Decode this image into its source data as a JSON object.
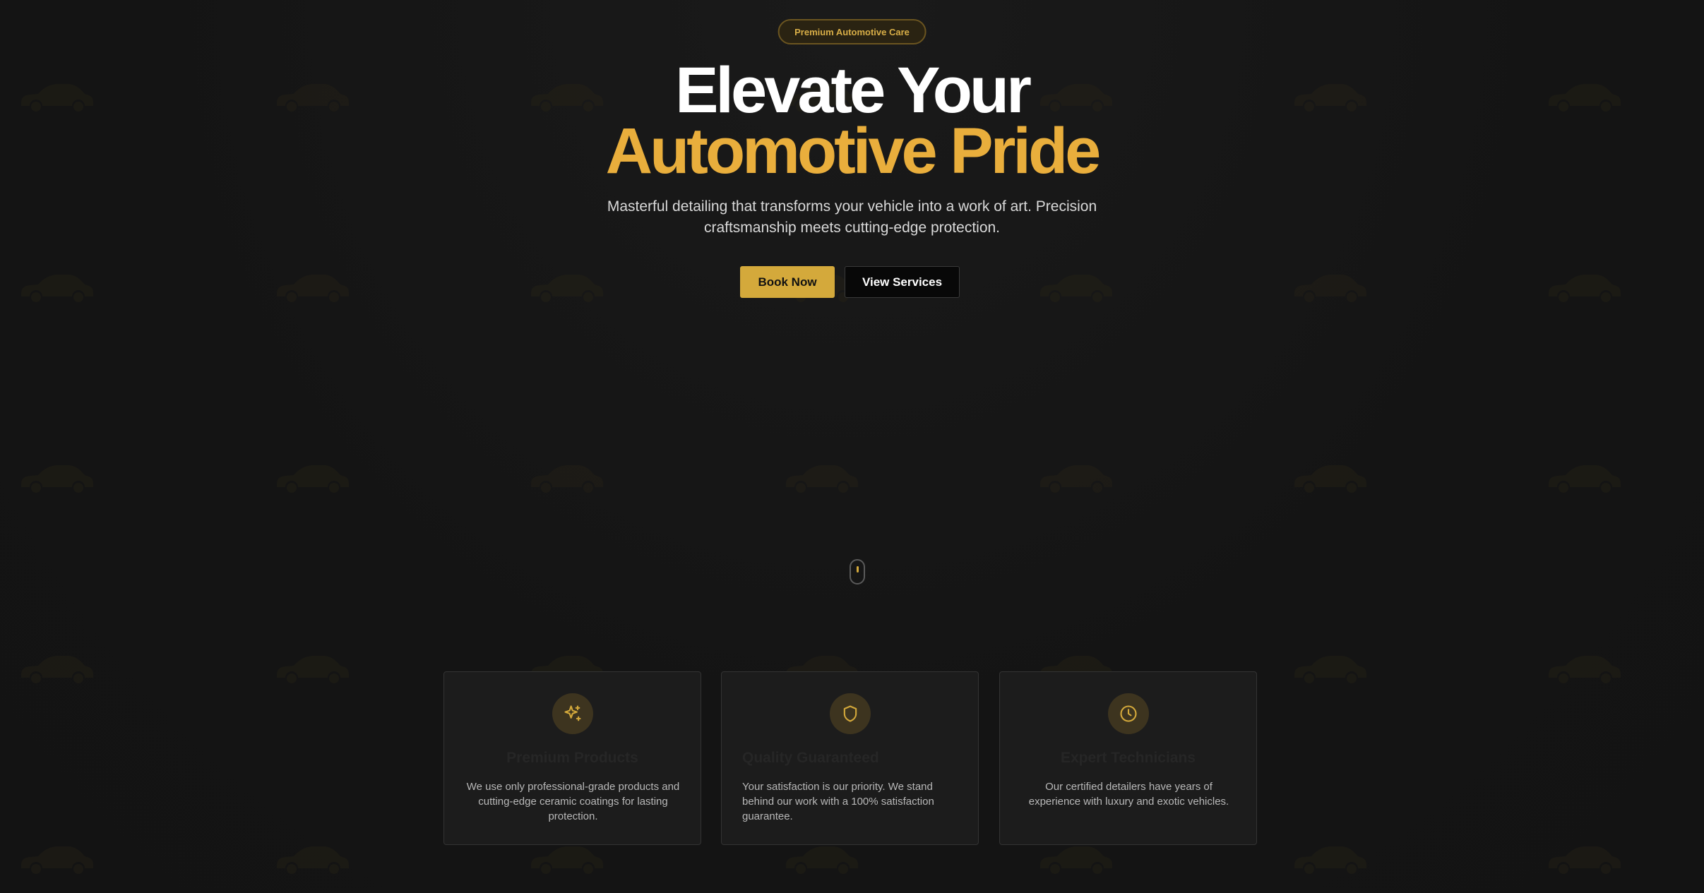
{
  "hero": {
    "badge": "Premium Automotive Care",
    "title_line1": "Elevate Your",
    "title_line2": "Automotive Pride",
    "subtitle": "Masterful detailing that transforms your vehicle into a work of art. Precision craftsmanship meets cutting-edge protection.",
    "primary_button": "Book Now",
    "secondary_button": "View Services"
  },
  "features": [
    {
      "icon": "sparkles-icon",
      "title": "Premium Products",
      "text": "We use only professional-grade products and cutting-edge ceramic coatings for lasting protection."
    },
    {
      "icon": "shield-icon",
      "title": "Quality Guaranteed",
      "text": "Your satisfaction is our priority. We stand behind our work with a 100% satisfaction guarantee."
    },
    {
      "icon": "clock-icon",
      "title": "Expert Technicians",
      "text": "Our certified detailers have years of experience with luxury and exotic vehicles."
    }
  ],
  "colors": {
    "background": "#161616",
    "accent": "#d4a93b",
    "accent_text": "#e9ae3c",
    "card_bg": "#1c1c1c"
  }
}
